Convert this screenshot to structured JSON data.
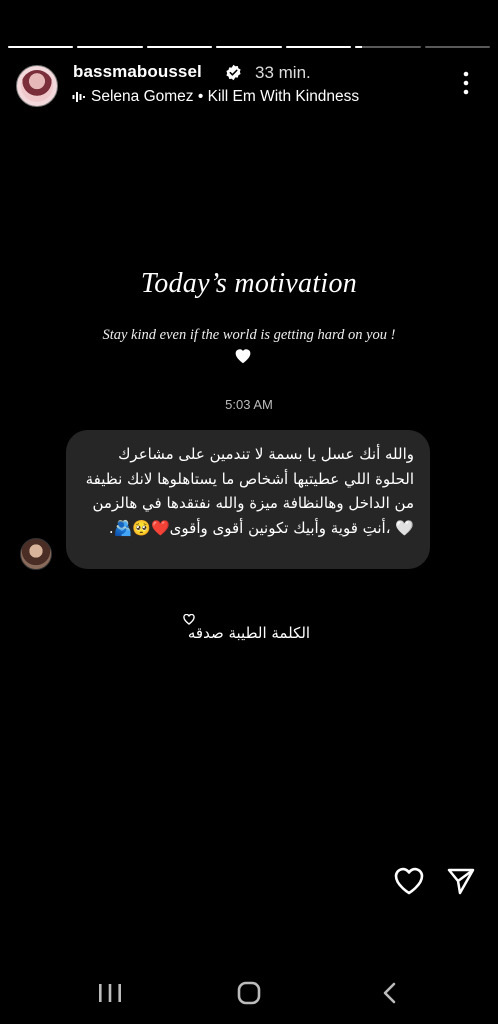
{
  "story": {
    "segments": [
      1,
      1,
      1,
      1,
      1,
      0.1,
      0
    ],
    "username": "bassmaboussel",
    "time_ago": "33 min.",
    "music": "Selena Gomez • Kill Em With Kindness"
  },
  "content": {
    "title": "Today’s motivation",
    "subtitle": "Stay kind even if the world is getting hard on you !",
    "timestamp": "5:03 AM",
    "message": "والله أنك عسل يا بسمة لا تندمين على مشاعرك الحلوة اللي عطيتيها أشخاص ما يستاهلوها لانك نظيفة من الداخل وهالنظافة ميزة والله نفتقدها في هالزمن 🤍 ،أنتِ قوية وأبيك تكونين أقوى وأقوى❤️🥺🫂.",
    "caption": "الكلمة الطيبة صدقه"
  },
  "icons": {
    "verified": "verified-badge-icon",
    "music": "audio-wave-icon",
    "more": "more-vertical-icon",
    "like": "heart-outline-icon",
    "send": "send-icon"
  },
  "colors": {
    "background": "#000000",
    "bubble": "#262626",
    "text": "#ffffff"
  }
}
